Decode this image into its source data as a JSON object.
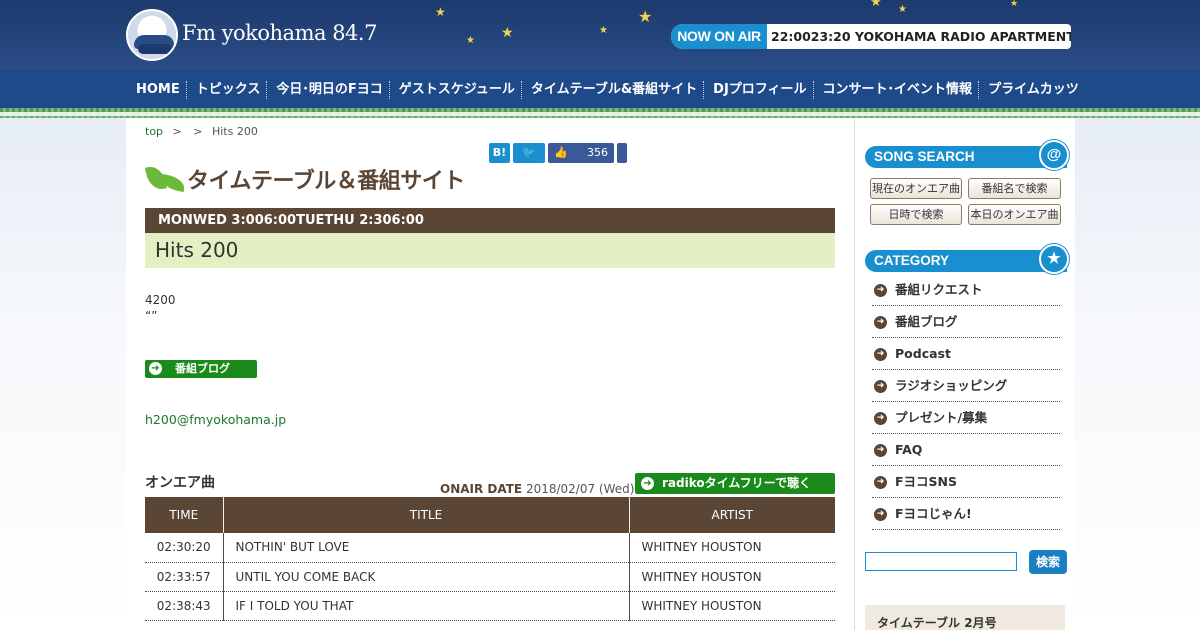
{
  "header": {
    "logo_text": "Fm yokohama 84.7",
    "now_on_air_label": "NOW ON AIR",
    "now_on_air_text": "22:0023:20  YOKOHAMA RADIO APARTMENT"
  },
  "nav": {
    "items": [
      "HOME",
      "トピックス",
      "今日･明日のFヨコ",
      "ゲストスケジュール",
      "タイムテーブル&番組サイト",
      "DJプロフィール",
      "コンサート･イベント情報",
      "プライムカッツ"
    ]
  },
  "breadcrumb": {
    "top": "top",
    "sep1": ">",
    "sep2": ">",
    "current": "Hits 200"
  },
  "share": {
    "hatena": "B!",
    "twitter": "🐦",
    "like_icon": "👍",
    "like_count": "356"
  },
  "section_title": "タイムテーブル＆番組サイト",
  "program": {
    "time": "MONWED 3:006:00TUETHU 2:306:00",
    "title": "Hits 200",
    "desc_line1": "4200",
    "desc_line2": "“”",
    "blog_button": "番組ブログ",
    "email": "h200@fmyokohama.jp"
  },
  "onair": {
    "heading": "オンエア曲",
    "date_label": "ONAIR DATE",
    "date_value": " 2018/02/07 (Wed)",
    "radiko_button": "radikoタイムフリーで聴く",
    "columns": [
      "TIME",
      "TITLE",
      "ARTIST"
    ],
    "rows": [
      {
        "time": "02:30:20",
        "title": "NOTHIN' BUT LOVE",
        "artist": "WHITNEY HOUSTON"
      },
      {
        "time": "02:33:57",
        "title": "UNTIL YOU COME BACK",
        "artist": "WHITNEY HOUSTON"
      },
      {
        "time": "02:38:43",
        "title": "IF I TOLD YOU THAT",
        "artist": "WHITNEY HOUSTON"
      }
    ]
  },
  "sidebar": {
    "song_search": {
      "title": "SONG SEARCH",
      "buttons": [
        "現在のオンエア曲",
        "番組名で検索",
        "日時で検索",
        "本日のオンエア曲"
      ]
    },
    "category": {
      "title": "CATEGORY",
      "items": [
        "番組リクエスト",
        "番組ブログ",
        "Podcast",
        "ラジオショッピング",
        "プレゼント/募集",
        "FAQ",
        "FヨコSNS",
        "Fヨコじゃん!"
      ]
    },
    "search_button": "検索",
    "timetable_box": "タイムテーブル 2月号"
  },
  "colors": {
    "header_blue": "#1d3a6e",
    "nav_blue": "#1f4a8a",
    "accent_blue": "#1a8fd0",
    "brown": "#5b4636",
    "green": "#1a8a1a",
    "title_bg": "#e2f0c4"
  }
}
